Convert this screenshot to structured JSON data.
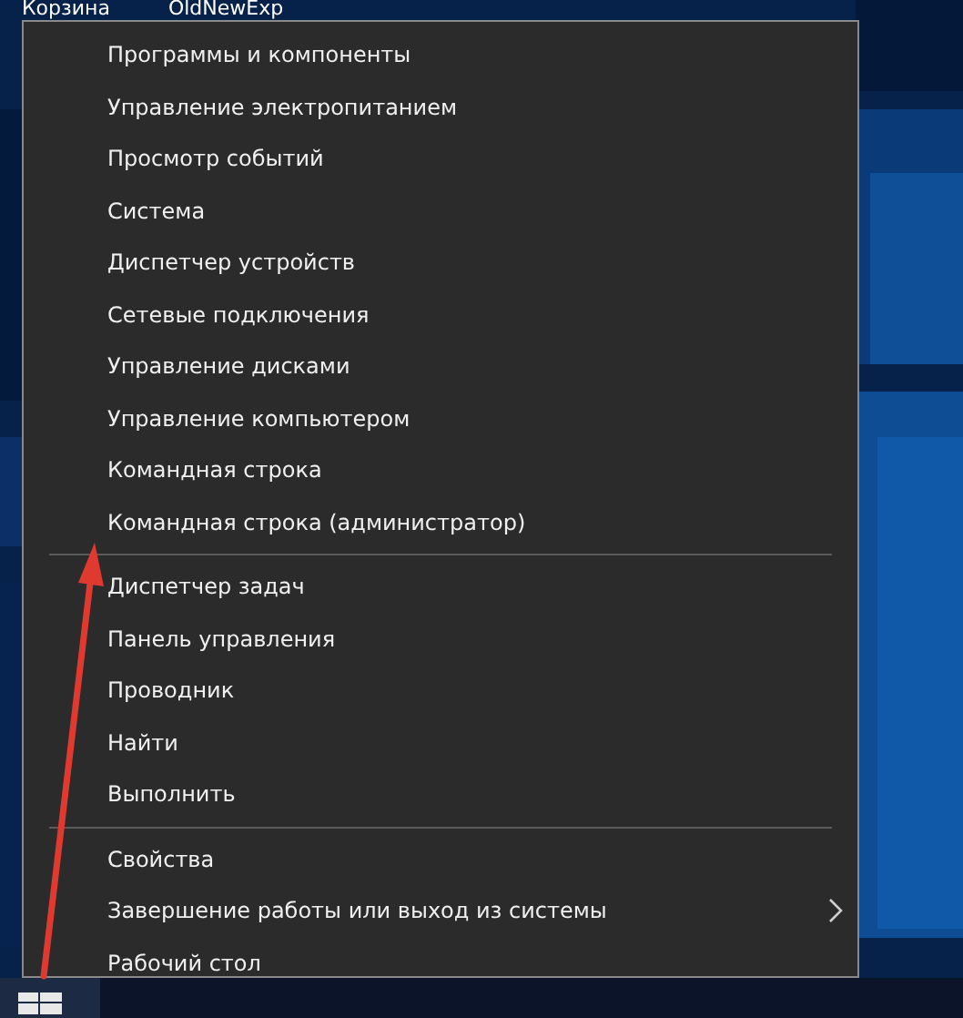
{
  "desktop_icons": [
    {
      "label": "Корзина"
    },
    {
      "label": "OldNewExp"
    }
  ],
  "menu": {
    "groups": [
      [
        {
          "label": "Программы и компоненты",
          "has_submenu": false
        },
        {
          "label": "Управление электропитанием",
          "has_submenu": false
        },
        {
          "label": "Просмотр событий",
          "has_submenu": false
        },
        {
          "label": "Система",
          "has_submenu": false
        },
        {
          "label": "Диспетчер устройств",
          "has_submenu": false
        },
        {
          "label": "Сетевые подключения",
          "has_submenu": false
        },
        {
          "label": "Управление дисками",
          "has_submenu": false
        },
        {
          "label": "Управление компьютером",
          "has_submenu": false
        },
        {
          "label": "Командная строка",
          "has_submenu": false
        },
        {
          "label": "Командная строка (администратор)",
          "has_submenu": false
        }
      ],
      [
        {
          "label": "Диспетчер задач",
          "has_submenu": false
        },
        {
          "label": "Панель управления",
          "has_submenu": false
        },
        {
          "label": "Проводник",
          "has_submenu": false
        },
        {
          "label": "Найти",
          "has_submenu": false
        },
        {
          "label": "Выполнить",
          "has_submenu": false
        }
      ],
      [
        {
          "label": "Свойства",
          "has_submenu": false
        },
        {
          "label": "Завершение работы или выход из системы",
          "has_submenu": true
        },
        {
          "label": "Рабочий стол",
          "has_submenu": false
        }
      ]
    ]
  }
}
